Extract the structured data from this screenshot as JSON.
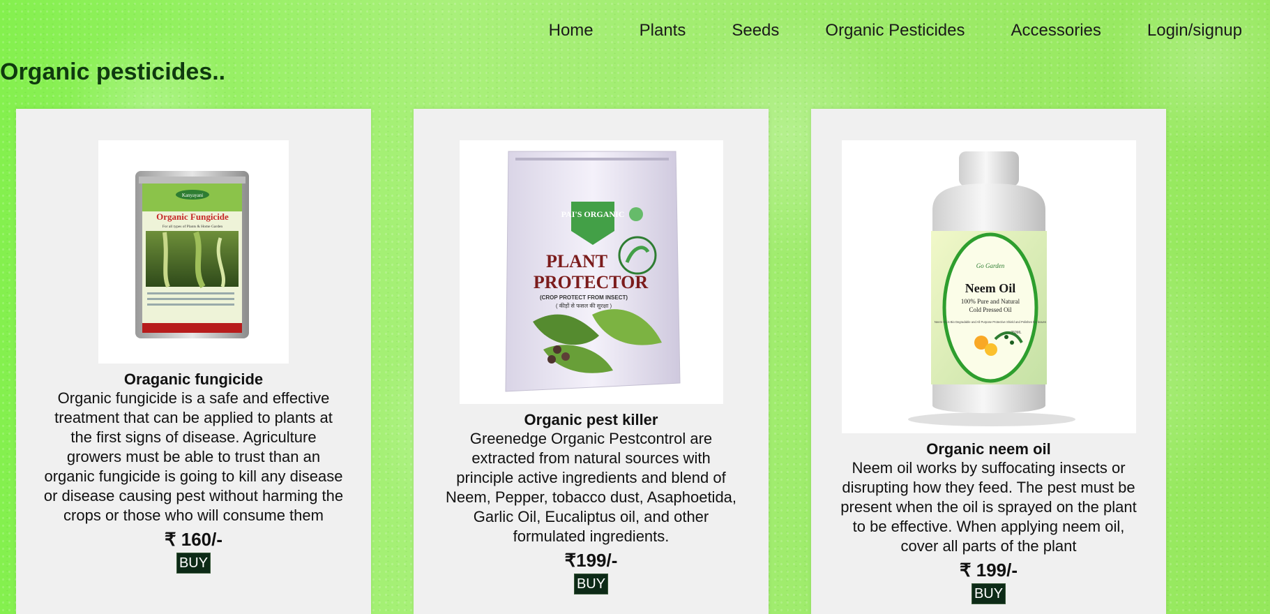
{
  "nav": {
    "items": [
      "Home",
      "Plants",
      "Seeds",
      "Organic Pesticides",
      "Accessories",
      "Login/signup"
    ]
  },
  "page": {
    "title": "Organic pesticides.."
  },
  "products": [
    {
      "name": "Oraganic fungicide",
      "description": "Organic fungicide is a safe and effective treatment that can be applied to plants at the first signs of disease. Agriculture growers must be able to trust than an organic fungicide is going to kill any disease or disease causing pest without harming the crops or those who will consume them",
      "price": "₹ 160/-",
      "buy_label": "BUY",
      "package": {
        "brand": "Kanyayani",
        "title": "Organic Fungicide",
        "subtitle": "For all types of Plants & Home Garden"
      }
    },
    {
      "name": "Organic pest killer",
      "description": "Greenedge Organic Pestcontrol are extracted from natural sources with principle active ingredients and blend of Neem, Pepper, tobacco dust, Asaphoetida, Garlic Oil, Eucaliptus oil, and other formulated ingredients.",
      "price": "₹199/-",
      "buy_label": "BUY",
      "package": {
        "brand": "PAI'S ORGANIC",
        "title_line1": "PLANT",
        "title_line2": "PROTECTOR",
        "subtitle": "(CROP PROTECT FROM INSECT)",
        "subtitle2": "( कीड़ों से फसल की सुरक्षा )"
      }
    },
    {
      "name": "Organic neem oil",
      "description": "Neem oil works by suffocating insects or disrupting how they feed. The pest must be present when the oil is sprayed on the plant to be effective. When applying neem oil, cover all parts of the plant",
      "price": "₹ 199/-",
      "buy_label": "BUY",
      "package": {
        "brand": "Go Garden",
        "title": "Neem Oil",
        "subtitle": "100% Pure and Natural",
        "subtitle2": "Cold Pressed Oil",
        "note": "Neem Oil is Bio Degradable and All Purpose Protective Shield and Polishes the leaves",
        "volume": "250ML"
      }
    }
  ],
  "colors": {
    "background": "#a3ee73",
    "card": "#f0f0f0",
    "buy_button": "#0d2a17",
    "title": "#0f3a0f"
  }
}
